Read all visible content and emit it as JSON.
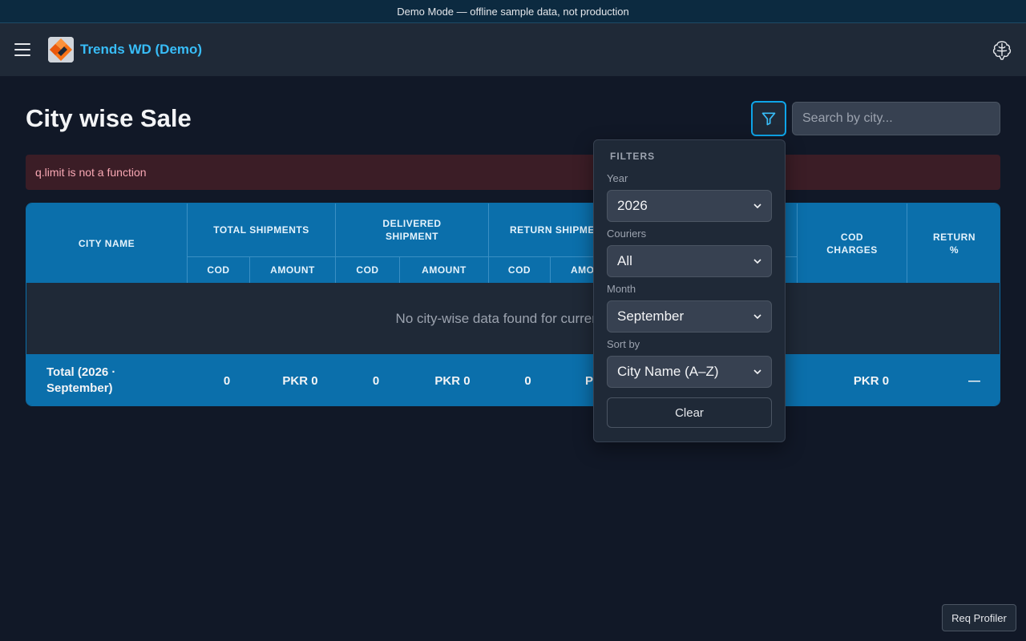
{
  "banner": {
    "text": "Demo Mode — offline sample data, not production"
  },
  "header": {
    "brand": "Trends WD (Demo)"
  },
  "page": {
    "title": "City wise Sale"
  },
  "search": {
    "placeholder": "Search by city..."
  },
  "error": {
    "message": "q.limit is not a function"
  },
  "table": {
    "headers": {
      "city_name": "CITY NAME",
      "total_shipments": "TOTAL SHIPMENTS",
      "delivered_shipment": "DELIVERED SHIPMENT",
      "return_shipment": "RETURN SHIPME",
      "cod_charges": "COD CHARGES",
      "return_pct": "RETURN %",
      "cod": "COD",
      "amount": "AMOUNT",
      "amount_partial": "AMO"
    },
    "empty_message": "No city-wise data found for current",
    "total_row": {
      "label": "Total (2026 · September)",
      "total_cod": "0",
      "total_amount": "PKR 0",
      "delivered_cod": "0",
      "delivered_amount": "PKR 0",
      "return_cod": "0",
      "return_amount_partial": "PI",
      "cod_charges": "PKR 0",
      "return_pct": "—"
    }
  },
  "filters": {
    "heading": "FILTERS",
    "year": {
      "label": "Year",
      "value": "2026"
    },
    "couriers": {
      "label": "Couriers",
      "value": "All"
    },
    "month": {
      "label": "Month",
      "value": "September"
    },
    "sort": {
      "label": "Sort by",
      "value": "City Name (A–Z)"
    },
    "clear_label": "Clear"
  },
  "profiler": {
    "label": "Req Profiler"
  },
  "colors": {
    "accent": "#0ea5e9",
    "brand": "#38bdf8",
    "table_header": "#0b6fab",
    "error_bg": "#3b1d26",
    "error_text": "#f9a8b4"
  },
  "icons": [
    "menu-icon",
    "logo-icon",
    "brain-icon",
    "filter-icon",
    "chevron-down-icon"
  ]
}
